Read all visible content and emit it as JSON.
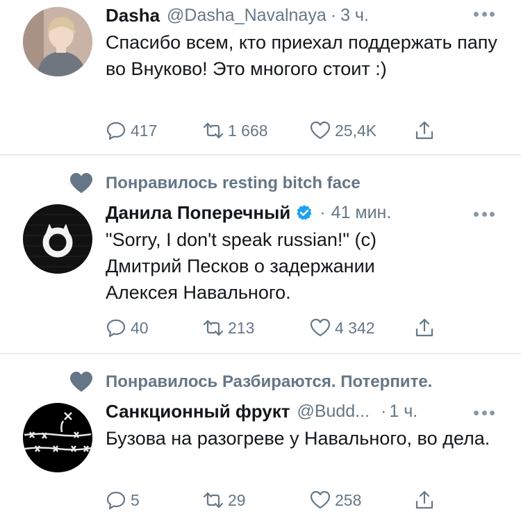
{
  "tweets": [
    {
      "social_context": "",
      "name": "Dasha",
      "handle": "@Dasha_Navalnaya",
      "dot": "·",
      "time": "3 ч.",
      "verified": false,
      "text": "Спасибо всем, кто приехал поддержать папу во Внуково! Это многого стоит :)",
      "replies": "417",
      "retweets": "1 668",
      "likes": "25,4K"
    },
    {
      "social_context": "Понравилось resting bitch face",
      "name": "Данила Поперечный",
      "handle": "",
      "dot": "·",
      "time": "41 мин.",
      "verified": true,
      "text": "\"Sorry, I don't speak russian!\" (c) Дмитрий Песков о задержании Алексея Навального.",
      "replies": "40",
      "retweets": "213",
      "likes": "4 342"
    },
    {
      "social_context": "Понравилось Разбираются. Потерпите.",
      "name": "Санкционный фрукт",
      "handle": "@Budd...",
      "dot": "·",
      "time": "1 ч.",
      "verified": false,
      "text": "Бузова на разогреве у Навального, во дела.",
      "replies": "5",
      "retweets": "29",
      "likes": "258"
    }
  ],
  "colors": {
    "text": "#14171a",
    "secondary": "#657786",
    "verified": "#1da1f2",
    "divider": "#e6ecf0"
  }
}
